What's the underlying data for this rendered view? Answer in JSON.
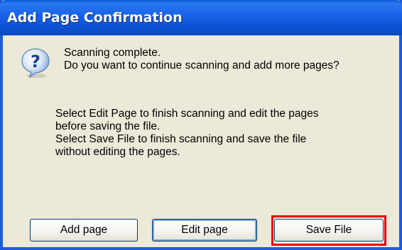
{
  "window": {
    "title": "Add Page Confirmation"
  },
  "icon": "question-mark-icon",
  "message": {
    "line1": "Scanning complete.",
    "line2": "Do you want to continue scanning and add more pages?"
  },
  "info": {
    "line1": "Select Edit Page to finish scanning and edit the pages",
    "line2": "before saving the file.",
    "line3": "Select Save File to finish scanning and save the file",
    "line4": "without editing the pages."
  },
  "buttons": {
    "add_page": "Add page",
    "edit_page": "Edit page",
    "save_file": "Save File"
  },
  "colors": {
    "titlebar": "#0b55d6",
    "dialog_bg": "#ece9d8",
    "highlight": "#e8000b"
  }
}
